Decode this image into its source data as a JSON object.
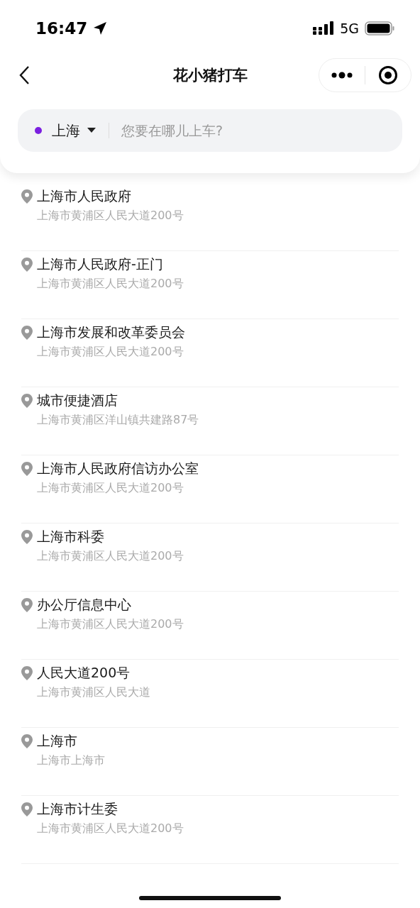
{
  "status_bar": {
    "time": "16:47",
    "network": "5G"
  },
  "nav_bar": {
    "title": "花小猪打车"
  },
  "search": {
    "city": "上海",
    "placeholder": "您要在哪儿上车?"
  },
  "places": [
    {
      "name": "上海市人民政府",
      "address": "上海市黄浦区人民大道200号"
    },
    {
      "name": "上海市人民政府-正门",
      "address": "上海市黄浦区人民大道200号"
    },
    {
      "name": "上海市发展和改革委员会",
      "address": "上海市黄浦区人民大道200号"
    },
    {
      "name": "城市便捷酒店",
      "address": "上海市黄浦区洋山镇共建路87号"
    },
    {
      "name": "上海市人民政府信访办公室",
      "address": "上海市黄浦区人民大道200号"
    },
    {
      "name": "上海市科委",
      "address": "上海市黄浦区人民大道200号"
    },
    {
      "name": "办公厅信息中心",
      "address": "上海市黄浦区人民大道200号"
    },
    {
      "name": "人民大道200号",
      "address": "上海市黄浦区人民大道"
    },
    {
      "name": "上海市",
      "address": "上海市上海市"
    },
    {
      "name": "上海市计生委",
      "address": "上海市黄浦区人民大道200号"
    }
  ]
}
